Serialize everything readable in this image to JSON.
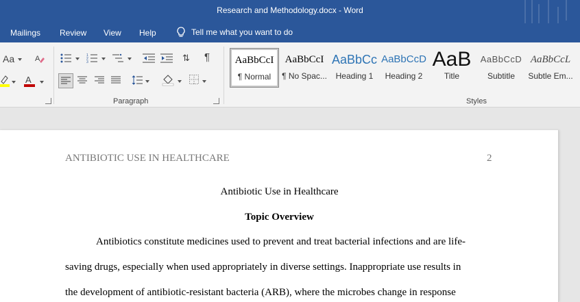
{
  "window": {
    "title": "Research and Methodology.docx  -  Word"
  },
  "tabs": [
    {
      "label": "Mailings"
    },
    {
      "label": "Review"
    },
    {
      "label": "View"
    },
    {
      "label": "Help"
    }
  ],
  "tell_me": {
    "placeholder": "Tell me what you want to do"
  },
  "ribbon": {
    "font_group": {
      "aa_label": "Aa"
    },
    "paragraph_group": {
      "label": "Paragraph"
    },
    "styles_group": {
      "label": "Styles",
      "items": [
        {
          "preview": "AaBbCcI",
          "name": "¶ Normal",
          "selected": true
        },
        {
          "preview": "AaBbCcI",
          "name": "¶ No Spac..."
        },
        {
          "preview": "AaBbCc",
          "name": "Heading 1"
        },
        {
          "preview": "AaBbCcD",
          "name": "Heading 2"
        },
        {
          "preview": "AaB",
          "name": "Title"
        },
        {
          "preview": "AaBbCcD",
          "name": "Subtitle"
        },
        {
          "preview": "AaBbCcL",
          "name": "Subtle Em..."
        }
      ]
    }
  },
  "colors": {
    "accent": "#2b579a",
    "heading_blue": "#2e74b5",
    "font_red": "#c00000",
    "highlight_yellow": "#ffff00"
  },
  "document": {
    "header": "ANTIBIOTIC USE IN HEALTHCARE",
    "page_number": "2",
    "title": "Antibiotic Use in Healthcare",
    "heading": "Topic Overview",
    "paragraph_lines": [
      "Antibiotics constitute medicines used to prevent and treat bacterial infections and are life-",
      "saving drugs, especially when used appropriately in diverse settings. Inappropriate use results in",
      "the development of antibiotic-resistant bacteria (ARB), where the microbes change in response"
    ]
  }
}
